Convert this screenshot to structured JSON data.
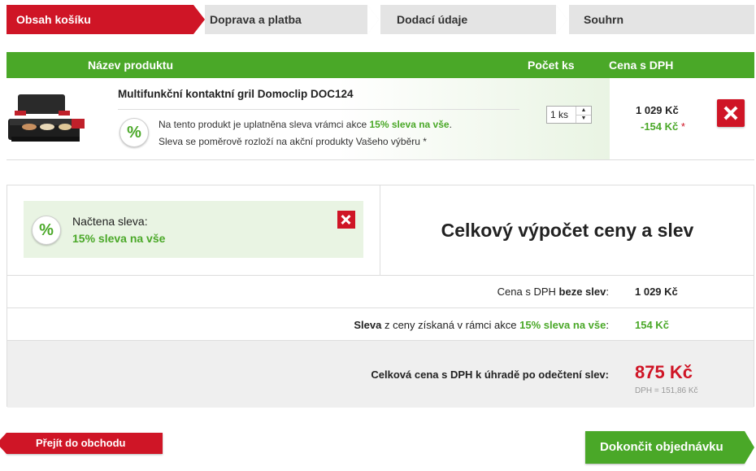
{
  "steps": [
    {
      "label": "Obsah košíku"
    },
    {
      "label": "Doprava a platba"
    },
    {
      "label": "Dodací údaje"
    },
    {
      "label": "Souhrn"
    }
  ],
  "table_header": {
    "product": "Název produktu",
    "quantity": "Počet ks",
    "price": "Cena s DPH"
  },
  "product": {
    "name": "Multifunkční kontaktní gril Domoclip DOC124",
    "discount_badge": "%",
    "discount_text_prefix": "Na tento produkt je uplatněna sleva vrámci akce",
    "discount_action": "15% sleva na vše",
    "discount_text_suffix": ".",
    "discount_note": "Sleva se poměrově rozloží na akční produkty Vašeho výběru *",
    "quantity": "1 ks",
    "price": "1 029 Kč",
    "price_discount": "-154 Kč",
    "price_star": "*"
  },
  "loaded_discount": {
    "badge": "%",
    "label": "Načtena sleva:",
    "value": "15% sleva na vše"
  },
  "calc_title": "Celkový výpočet ceny a slev",
  "summary": {
    "row1_prefix": "Cena s DPH ",
    "row1_bold": "beze slev",
    "row1_suffix": ":",
    "row1_amount": "1 029 Kč",
    "row2_bold": "Sleva",
    "row2_mid": " z ceny získaná v rámci akce ",
    "row2_action": "15% sleva na vše",
    "row2_suffix": ":",
    "row2_amount": "154 Kč",
    "row3_label": "Celková cena s DPH k úhradě po odečtení slev:",
    "row3_amount": "875 Kč",
    "row3_vat": "DPH = 151,86 Kč"
  },
  "buttons": {
    "back": "Přejít do obchodu",
    "finish": "Dokončit objednávku"
  },
  "colors": {
    "red": "#cf1526",
    "green": "#4aa828",
    "grey": "#e4e4e4"
  }
}
